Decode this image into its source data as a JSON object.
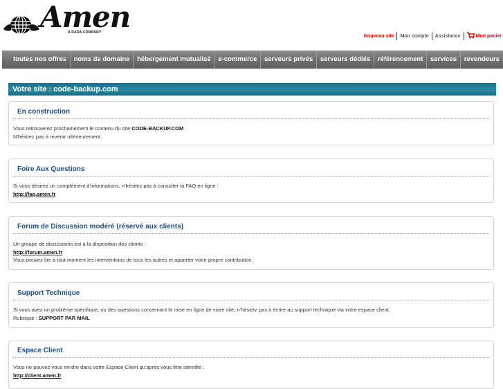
{
  "brand": {
    "name": "Amen",
    "tagline": "A DADA COMPANY"
  },
  "toplinks": {
    "new_site": "Nouveau site",
    "account": "Mon compte",
    "support": "Assistance",
    "cart": "Mon panier"
  },
  "nav": [
    "toutes nos offres",
    "noms de domaine",
    "hébergement mutualisé",
    "e-commerce",
    "serveurs privés",
    "serveurs dédiés",
    "référencement",
    "services",
    "revendeurs"
  ],
  "page_title": "Votre site : code-backup.com",
  "sections": {
    "construction": {
      "title": "En construction",
      "line1_pre": "Vous retrouverez prochainement le contenu du site ",
      "line1_site": "CODE-BACKUP.COM",
      "line2": "N'hésitez pas à revenir ultérieurement."
    },
    "faq": {
      "title": "Foire Aux Questions",
      "line1": "Si vous désirez un complément d'informations, n'hésitez pas à consulter la FAQ en ligne :",
      "link": "http://faq.amen.fr"
    },
    "forum": {
      "title": "Forum de Discussion modéré (réservé aux clients)",
      "line1": "Un groupe de discussions est à la disposition des clients :",
      "link": "http://forum.amen.fr",
      "line2": "Vous pouvez lire à tout moment les interventions de tous les autres et apporter votre propre contribution."
    },
    "support": {
      "title": "Support Technique",
      "line1": "Si vous avez un problème spécifique, ou des questions concernant la mise en ligne de votre site, n'hésitez pas à écrire au support technique via votre espace client.",
      "line2_pre": "Rubrique : ",
      "line2_bold": "SUPPORT PAR MAIL"
    },
    "client": {
      "title": "Espace Client",
      "line1": "Vous ne pouvez vous rendre dans votre Espace Client qu'après vous être identifié :",
      "link": "http://client.amen.fr"
    }
  }
}
